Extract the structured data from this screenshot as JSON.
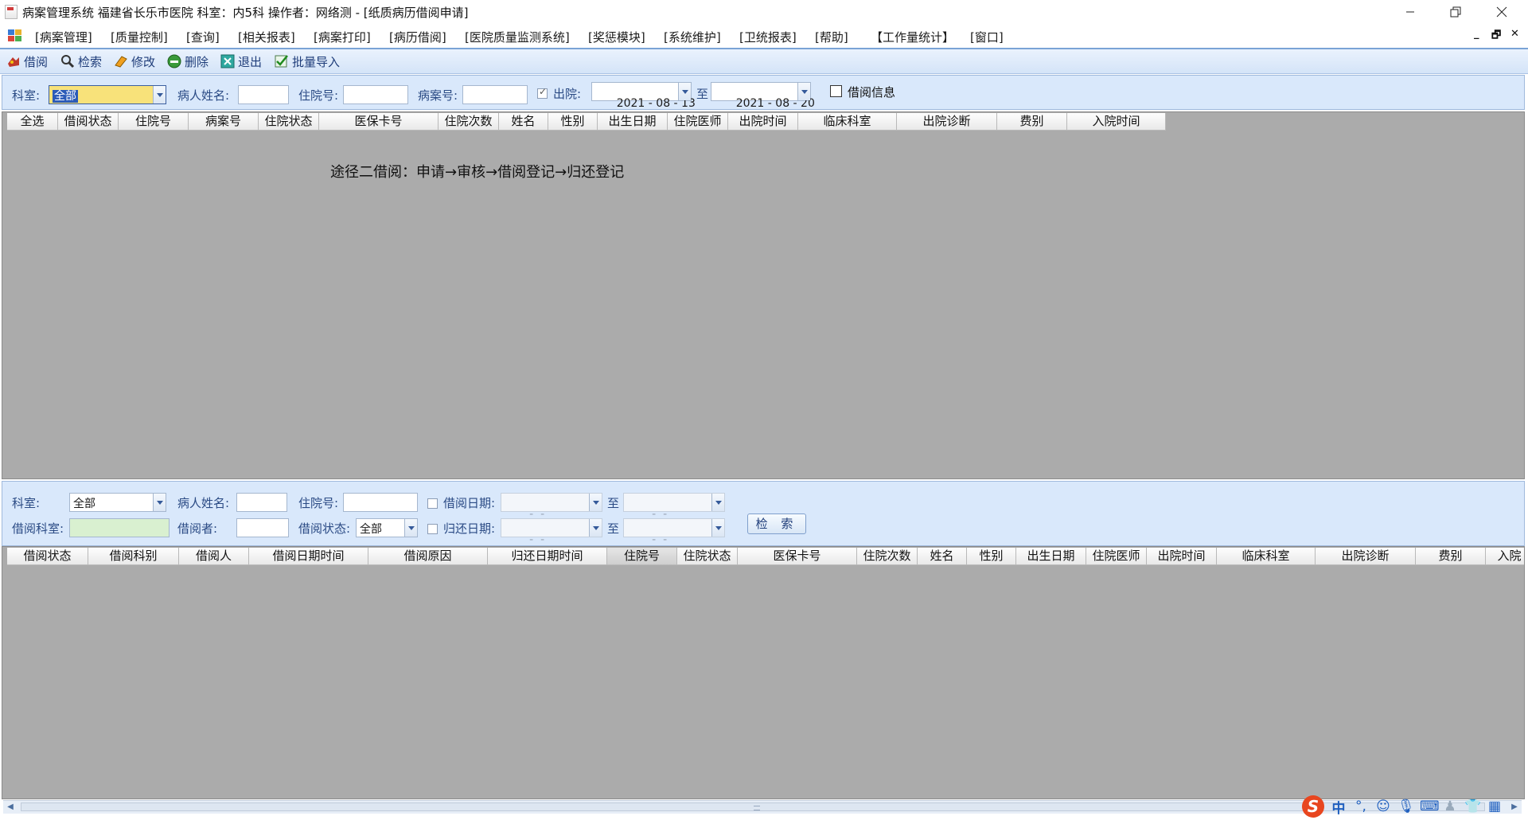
{
  "window": {
    "title": "病案管理系统  福建省长乐市医院  科室：内5科 操作者：网络测 - [纸质病历借阅申请]"
  },
  "menu": {
    "items": [
      "[病案管理]",
      "[质量控制]",
      "[查询]",
      "[相关报表]",
      "[病案打印]",
      "[病历借阅]",
      "[医院质量监测系统]",
      "[奖惩模块]",
      "[系统维护]",
      "[卫统报表]",
      "[帮助]",
      "【工作量统计】",
      "[窗口]"
    ]
  },
  "toolbar": {
    "borrow": "借阅",
    "search": "检索",
    "edit": "修改",
    "delete": "删除",
    "exit": "退出",
    "batch_import": "批量导入"
  },
  "top_filter": {
    "dept_label": "科室:",
    "dept_value": "全部",
    "patient_name_label": "病人姓名:",
    "inpatient_no_label": "住院号:",
    "record_no_label": "病案号:",
    "discharge_label": "出院:",
    "discharge_checked": true,
    "date_from": "2021 - 08 - 13",
    "to_label": "至",
    "date_to": "2021 - 08 - 20",
    "borrow_info_label": "借阅信息"
  },
  "top_grid": {
    "columns": [
      "全选",
      "借阅状态",
      "住院号",
      "病案号",
      "住院状态",
      "医保卡号",
      "住院次数",
      "姓名",
      "性别",
      "出生日期",
      "住院医师",
      "出院时间",
      "临床科室",
      "出院诊断",
      "费别",
      "入院时间"
    ],
    "note": "途径二借阅：申请→审核→借阅登记→归还登记"
  },
  "bottom_filter": {
    "dept_label": "科室:",
    "dept_value": "全部",
    "patient_name_label": "病人姓名:",
    "inpatient_no_label": "住院号:",
    "borrow_date_label": "借阅日期:",
    "borrow_date_from": " -  - ",
    "to_label": "至",
    "borrow_date_to": " -  - ",
    "borrow_dept_label": "借阅科室:",
    "borrower_label": "借阅者:",
    "borrow_status_label": "借阅状态:",
    "borrow_status_value": "全部",
    "return_date_label": "归还日期:",
    "return_date_from": " -  - ",
    "return_date_to": " -  - ",
    "search_button": "检 索"
  },
  "bottom_grid": {
    "columns": [
      "借阅状态",
      "借阅科别",
      "借阅人",
      "借阅日期时间",
      "借阅原因",
      "归还日期时间",
      "住院号",
      "住院状态",
      "医保卡号",
      "住院次数",
      "姓名",
      "性别",
      "出生日期",
      "住院医师",
      "出院时间",
      "临床科室",
      "出院诊断",
      "费别",
      "入院"
    ],
    "selected_column": "住院号"
  },
  "ime": {
    "logo": "S",
    "mode": "中"
  }
}
